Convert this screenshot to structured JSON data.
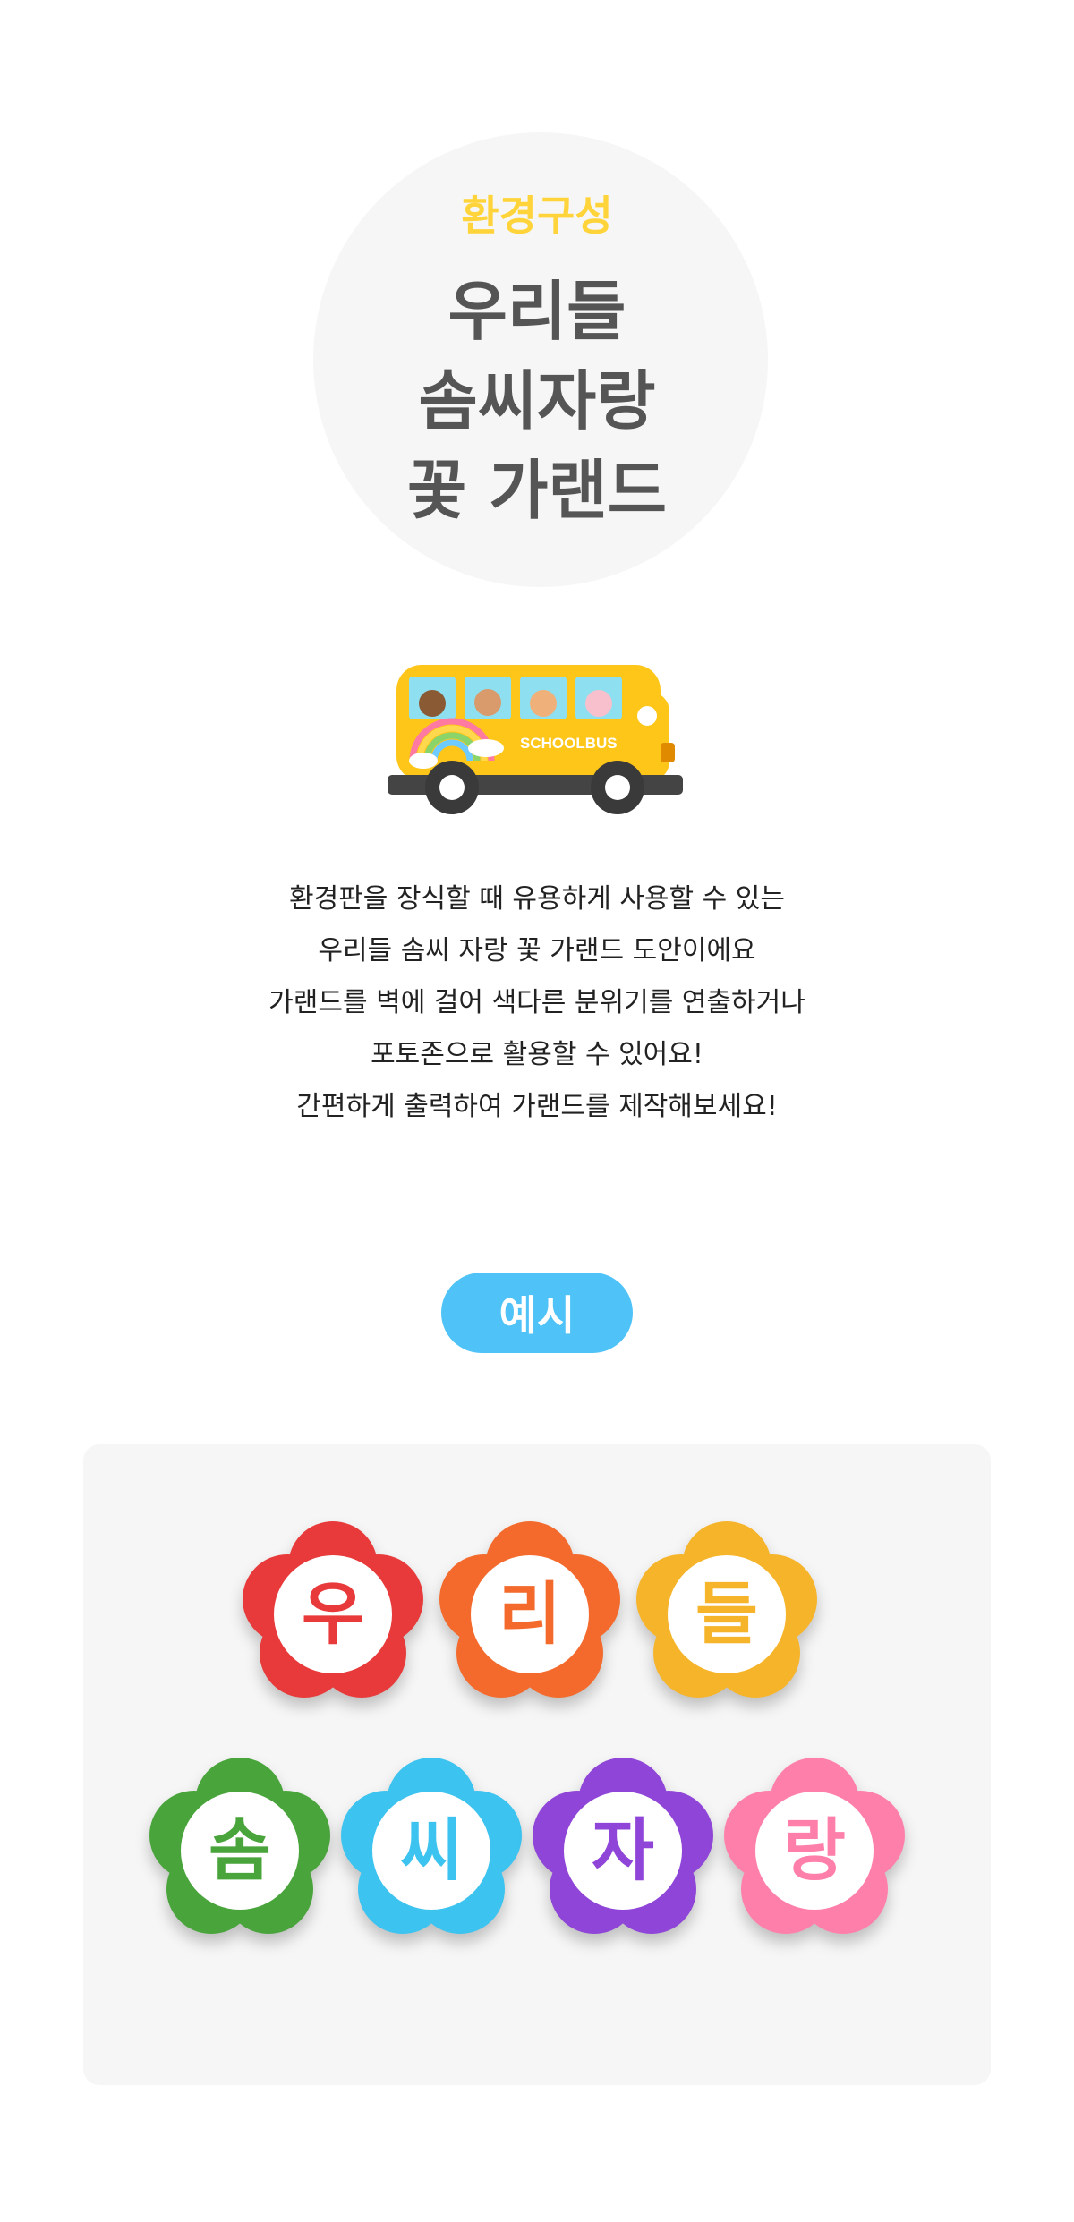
{
  "header": {
    "eyebrow": "환경구성",
    "title_lines": [
      "우리들",
      "솜씨자랑",
      "꽃 가랜드"
    ]
  },
  "illustration": {
    "bus_text": "SCHOOLBUS"
  },
  "description": {
    "lines": [
      "환경판을 장식할 때 유용하게 사용할 수 있는",
      "우리들 솜씨 자랑 꽃 가랜드 도안이에요",
      "가랜드를 벽에 걸어 색다른 분위기를 연출하거나",
      "포토존으로 활용할 수 있어요!",
      "간편하게 출력하여 가랜드를 제작해보세요!"
    ]
  },
  "example": {
    "label": "예시",
    "flowers": [
      {
        "text": "우",
        "color": "#e83a3a"
      },
      {
        "text": "리",
        "color": "#f36a2c"
      },
      {
        "text": "들",
        "color": "#f6b42a"
      },
      {
        "text": "솜",
        "color": "#49a43b"
      },
      {
        "text": "씨",
        "color": "#3cc3ef"
      },
      {
        "text": "자",
        "color": "#8f45d8"
      },
      {
        "text": "랑",
        "color": "#ff7fab"
      }
    ]
  },
  "colors": {
    "eyebrow": "#ffd43b",
    "title": "#555555",
    "accent": "#4fc3f7",
    "panel": "#f6f6f6"
  }
}
